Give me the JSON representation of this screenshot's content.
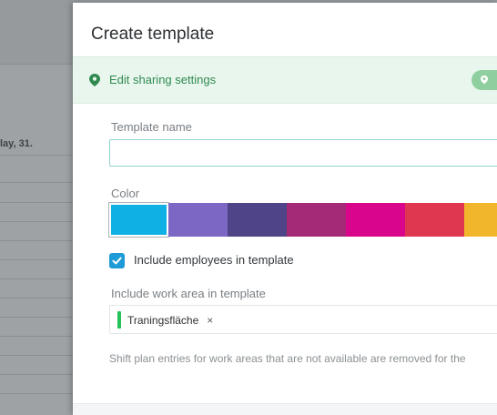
{
  "background": {
    "date_fragment": "lay, 31."
  },
  "modal": {
    "title": "Create template",
    "sharing": {
      "link_label": "Edit sharing settings",
      "pin_icon": "map-pin-icon",
      "accent": "#2f8a4f",
      "bar_color": "#e9f6ee"
    },
    "template_name": {
      "label": "Template name",
      "value": "",
      "placeholder": ""
    },
    "color": {
      "label": "Color",
      "selected_index": 0,
      "swatches": [
        "#0fb0e3",
        "#7d67c4",
        "#4e4487",
        "#a42a78",
        "#d9068b",
        "#e03750",
        "#f2b62c"
      ]
    },
    "include_employees": {
      "label": "Include employees in template",
      "checked": true
    },
    "work_area": {
      "label": "Include work area in template",
      "chips": [
        {
          "label": "Traningsfläche",
          "color": "#24c35a",
          "remove_symbol": "×"
        }
      ]
    },
    "note": "Shift plan entries for work areas that are not available are removed for the"
  }
}
